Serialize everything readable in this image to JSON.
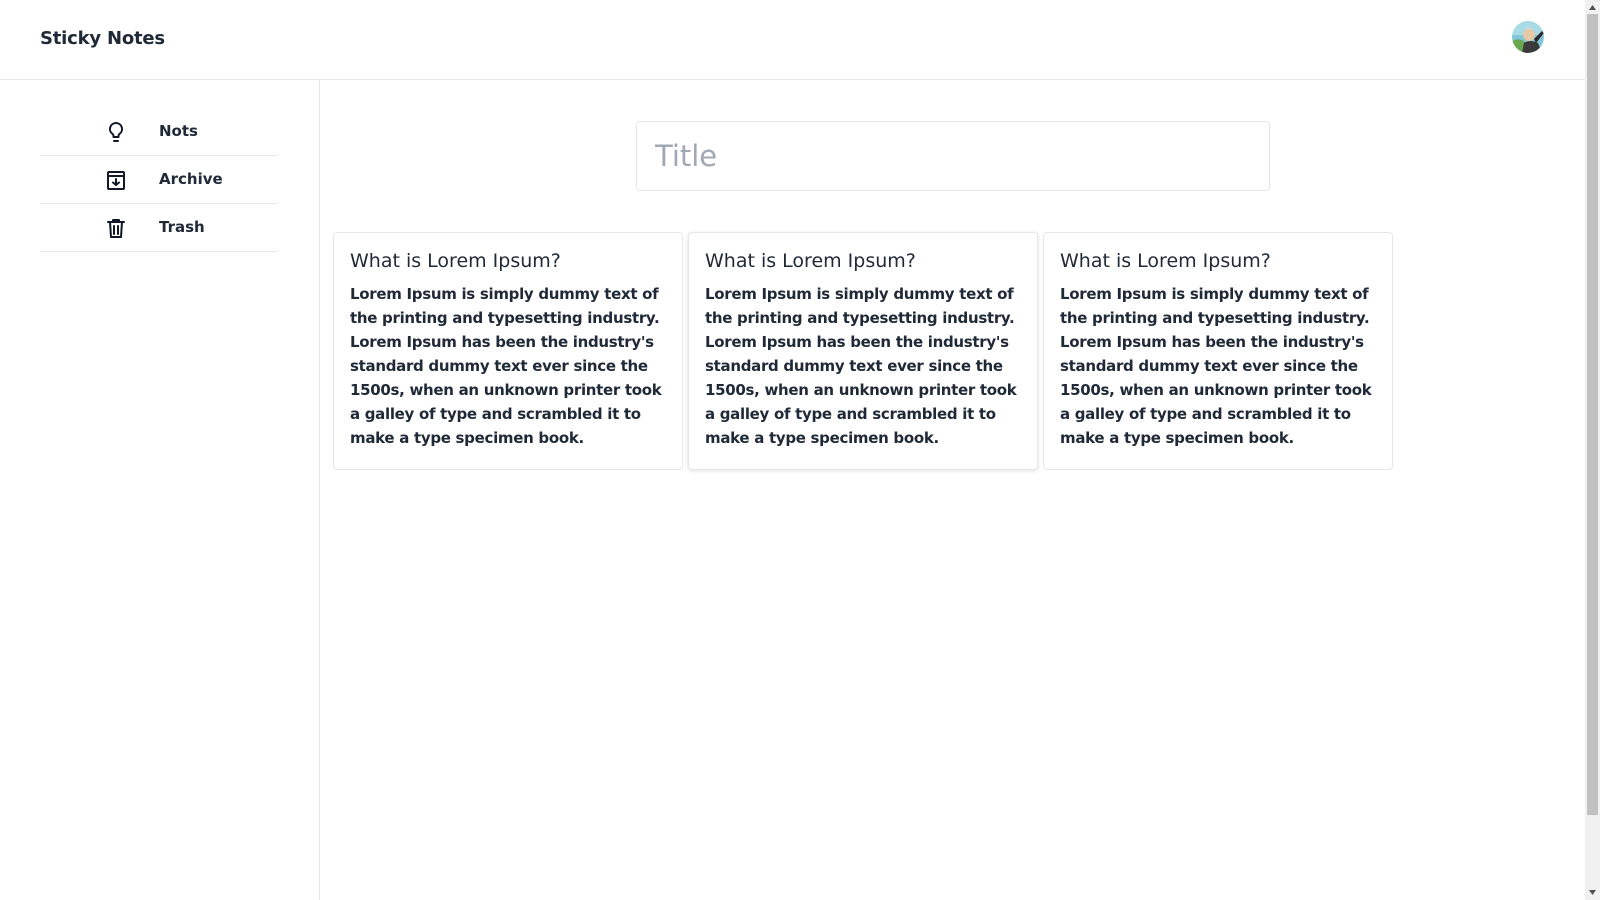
{
  "header": {
    "app_title": "Sticky Notes"
  },
  "sidebar": {
    "items": [
      {
        "label": "Nots",
        "icon": "lightbulb-icon"
      },
      {
        "label": "Archive",
        "icon": "archive-icon"
      },
      {
        "label": "Trash",
        "icon": "trash-icon"
      }
    ]
  },
  "new_note": {
    "title_placeholder": "Title"
  },
  "notes": [
    {
      "title": "What is Lorem Ipsum?",
      "body": "Lorem Ipsum is simply dummy text of the printing and typesetting industry. Lorem Ipsum has been the industry's standard dummy text ever since the 1500s, when an unknown printer took a galley of type and scrambled it to make a type specimen book."
    },
    {
      "title": "What is Lorem Ipsum?",
      "body": "Lorem Ipsum is simply dummy text of the printing and typesetting industry. Lorem Ipsum has been the industry's standard dummy text ever since the 1500s, when an unknown printer took a galley of type and scrambled it to make a type specimen book."
    },
    {
      "title": "What is Lorem Ipsum?",
      "body": "Lorem Ipsum is simply dummy text of the printing and typesetting industry. Lorem Ipsum has been the industry's standard dummy text ever since the 1500s, when an unknown printer took a galley of type and scrambled it to make a type specimen book."
    }
  ],
  "colors": {
    "text": "#1f2937",
    "border": "#e5e7eb",
    "placeholder": "#a0a8b4"
  }
}
